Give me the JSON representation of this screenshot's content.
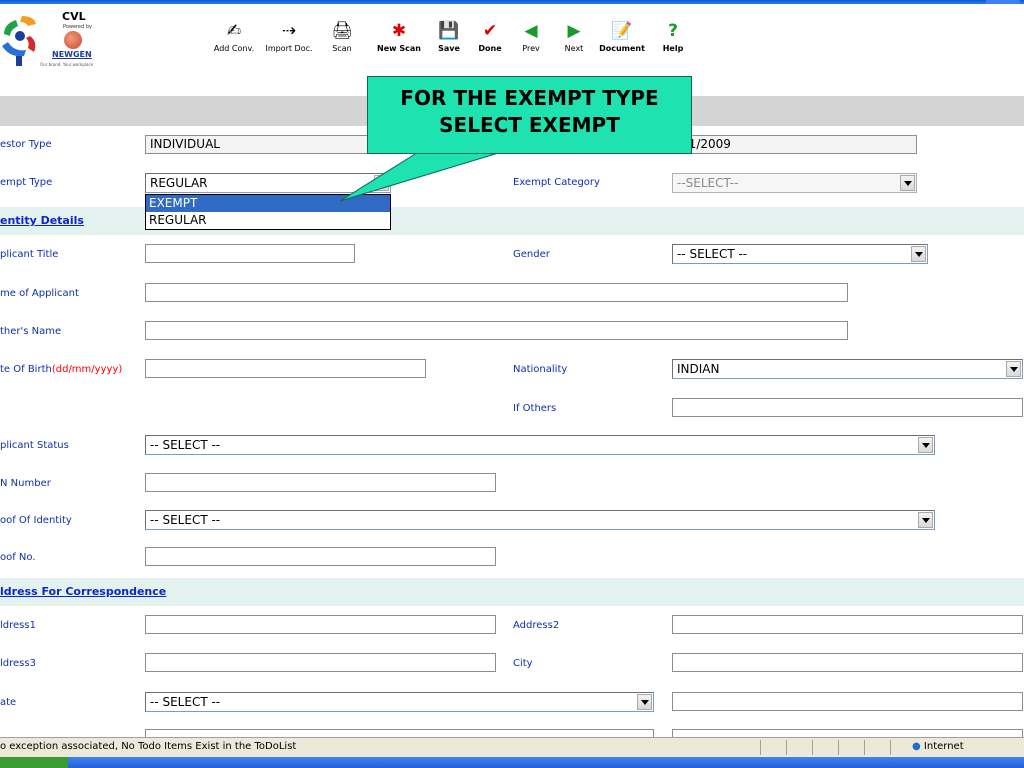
{
  "logo": {
    "name": "CVL",
    "powered_by": "Powered by",
    "brand": "NEWGEN",
    "tagline": "Our brand. Your workplace"
  },
  "toolbar": [
    {
      "label": "Add Conv.",
      "icon": "add-conv-icon"
    },
    {
      "label": "Import Doc.",
      "icon": "import-doc-icon"
    },
    {
      "label": "Scan",
      "icon": "scan-icon"
    },
    {
      "label": "New Scan",
      "icon": "new-scan-icon"
    },
    {
      "label": "Save",
      "icon": "save-icon"
    },
    {
      "label": "Done",
      "icon": "done-icon"
    },
    {
      "label": "Prev",
      "icon": "prev-icon"
    },
    {
      "label": "Next",
      "icon": "next-icon"
    },
    {
      "label": "Document",
      "icon": "document-icon"
    },
    {
      "label": "Help",
      "icon": "help-icon"
    }
  ],
  "callout": {
    "line1": "FOR THE EXEMPT TYPE",
    "line2": "SELECT EXEMPT",
    "color": "#1ee3b0"
  },
  "form": {
    "investor_type": {
      "label": "estor Type",
      "value": "INDIVIDUAL"
    },
    "date_value": "/01/2009",
    "exempt_type": {
      "label": "empt Type",
      "value": "REGULAR",
      "options": [
        "EXEMPT",
        "REGULAR"
      ],
      "highlighted": "EXEMPT"
    },
    "exempt_category": {
      "label": "Exempt Category",
      "value": "--SELECT--"
    },
    "identity_section": "entity Details",
    "applicant_title": {
      "label": "plicant Title",
      "value": ""
    },
    "gender": {
      "label": "Gender",
      "value": "-- SELECT --"
    },
    "name_of_applicant": {
      "label": "me of Applicant",
      "value": ""
    },
    "fathers_name": {
      "label": "ther's Name",
      "value": ""
    },
    "date_of_birth": {
      "label": "te Of Birth",
      "format": "(dd/mm/yyyy)",
      "value": ""
    },
    "nationality": {
      "label": "Nationality",
      "value": "INDIAN"
    },
    "if_others": {
      "label": "If Others",
      "value": ""
    },
    "applicant_status": {
      "label": "plicant Status",
      "value": "-- SELECT --"
    },
    "pan_number": {
      "label": "N Number",
      "value": ""
    },
    "proof_of_identity": {
      "label": "oof Of Identity",
      "value": "-- SELECT --"
    },
    "proof_no": {
      "label": "oof No.",
      "value": ""
    },
    "address_section": "ldress For Correspondence",
    "address1": {
      "label": "ldress1",
      "value": ""
    },
    "address2": {
      "label": "Address2",
      "value": ""
    },
    "address3": {
      "label": "ldress3",
      "value": ""
    },
    "city": {
      "label": "City",
      "value": ""
    },
    "state": {
      "label": "ate",
      "value": "-- SELECT --"
    }
  },
  "status_bar": {
    "message": "o exception associated, No Todo Items Exist in the ToDoList",
    "zone": "Internet"
  },
  "colors": {
    "label_blue": "#0f2fb0",
    "section_bg": "#e3f2ee",
    "highlight": "#316ac5",
    "date_format_red": "#ff0000"
  }
}
